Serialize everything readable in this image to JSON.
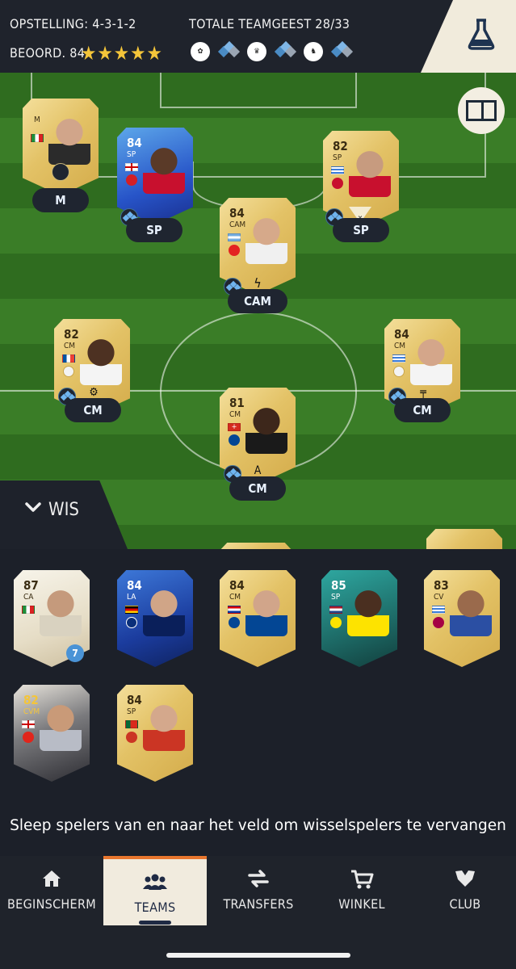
{
  "header": {
    "formation": "OPSTELLING: 4-3-1-2",
    "team_chem": "TOTALE TEAMGEEST 28/33",
    "rating": "BEOORD. 84",
    "stars": "★★★★★",
    "chem_sources": [
      "laliga-logo",
      "chem-diamonds",
      "real-madrid-logo",
      "chem-diamonds",
      "premier-league-logo",
      "chem-diamonds"
    ]
  },
  "pitch_players": [
    {
      "name": "manager",
      "rating": "",
      "pos": "M",
      "pill": "M"
    },
    {
      "name": "rashford",
      "rating": "84",
      "pos": "SP",
      "pill": "SP"
    },
    {
      "name": "nunez",
      "rating": "82",
      "pos": "SP",
      "pill": "SP"
    },
    {
      "name": "papu-gomez",
      "rating": "84",
      "pos": "CAM",
      "pill": "CAM"
    },
    {
      "name": "tchouameni",
      "rating": "82",
      "pos": "CM",
      "pill": "CM"
    },
    {
      "name": "valverde",
      "rating": "84",
      "pos": "CM",
      "pill": "CM"
    },
    {
      "name": "zakaria",
      "rating": "81",
      "pos": "CM",
      "pill": "CM"
    }
  ],
  "wis_label": "WIS",
  "bench": [
    {
      "rating": "87",
      "pos": "CA",
      "badge": "7"
    },
    {
      "rating": "84",
      "pos": "LA"
    },
    {
      "rating": "84",
      "pos": "CM"
    },
    {
      "rating": "85",
      "pos": "SP"
    },
    {
      "rating": "83",
      "pos": "CV"
    },
    {
      "rating": "82",
      "pos": "CVM"
    },
    {
      "rating": "84",
      "pos": "SP"
    }
  ],
  "hint": "Sleep spelers van en naar het veld om wisselspelers te vervangen",
  "nav": [
    {
      "label": "BEGINSCHERM",
      "icon": "home-icon"
    },
    {
      "label": "TEAMS",
      "icon": "people-icon",
      "active": true
    },
    {
      "label": "TRANSFERS",
      "icon": "swap-icon"
    },
    {
      "label": "WINKEL",
      "icon": "cart-icon"
    },
    {
      "label": "CLUB",
      "icon": "crest-icon"
    }
  ],
  "colors": {
    "accent": "#e8762e",
    "gold": "#f4c53a",
    "pitch": "#2f6c1f"
  }
}
